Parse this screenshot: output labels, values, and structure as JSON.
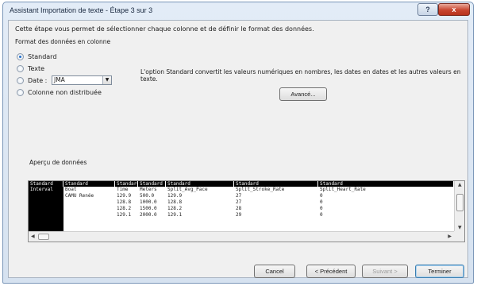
{
  "window": {
    "title": "Assistant Importation de texte - Étape 3 sur 3",
    "help_label": "?",
    "close_label": "x"
  },
  "intro": "Cette étape vous permet de sélectionner chaque colonne et de définir le format des données.",
  "column_format": {
    "legend": "Format des données en colonne",
    "options": [
      {
        "label": "Standard",
        "selected": true
      },
      {
        "label": "Texte",
        "selected": false
      },
      {
        "label": "Date :",
        "selected": false
      },
      {
        "label": "Colonne non distribuée",
        "selected": false
      }
    ],
    "date_value": "JMA"
  },
  "description": "L'option Standard convertit les valeurs numériques en nombres, les dates en dates et les autres valeurs en texte.",
  "advanced_label": "Avancé...",
  "preview": {
    "label": "Aperçu de données",
    "columns": [
      {
        "header": "Standard",
        "cells": [
          "Interval",
          "",
          "",
          "",
          ""
        ]
      },
      {
        "header": "Standard",
        "cells": [
          "Boat",
          "CAMU Renée",
          "",
          "",
          ""
        ]
      },
      {
        "header": "Standard",
        "cells": [
          "Time",
          "129.9",
          "128.8",
          "128.2",
          "129.1"
        ]
      },
      {
        "header": "Standard",
        "cells": [
          "Meters",
          "500.0",
          "1000.0",
          "1500.0",
          "2000.0"
        ]
      },
      {
        "header": "Standard",
        "cells": [
          "Split_Avg_Pace",
          "129.9",
          "128.8",
          "128.2",
          "129.1"
        ]
      },
      {
        "header": "Standard",
        "cells": [
          "Split_Stroke_Rate",
          "27",
          "27",
          "28",
          "29"
        ]
      },
      {
        "header": "Standard",
        "cells": [
          "Split_Heart_Rate",
          "0",
          "0",
          "0",
          "0"
        ]
      }
    ]
  },
  "buttons": {
    "cancel": "Cancel",
    "previous": "< Précédent",
    "next": "Suivant >",
    "finish": "Terminer"
  }
}
